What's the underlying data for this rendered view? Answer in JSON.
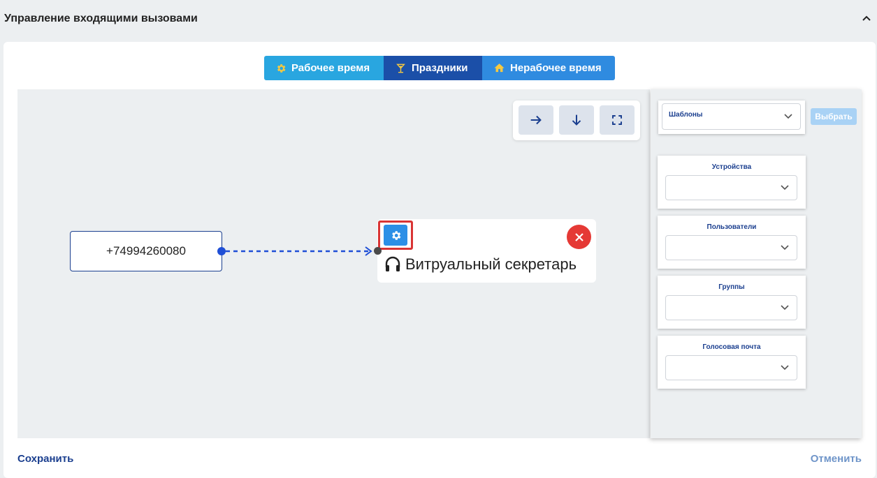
{
  "header": {
    "title": "Управление входящими вызовами",
    "collapse_icon": "chevron-up-icon"
  },
  "tabs": [
    {
      "label": "Рабочее время",
      "icon": "gear-icon",
      "color": "#29a6e0"
    },
    {
      "label": "Праздники",
      "icon": "cocktail-icon",
      "color": "#1b4fa8"
    },
    {
      "label": "Нерабочее время",
      "icon": "home-icon",
      "color": "#2f8be0"
    }
  ],
  "toolbar": {
    "icons": [
      "arrow-right-icon",
      "arrow-down-icon",
      "fullscreen-icon"
    ]
  },
  "flow": {
    "phone_number": "+74994260080",
    "secretary_label": "Витруальный секретарь",
    "secretary_icon": "headset-icon"
  },
  "sidebar": {
    "templates_label": "Шаблоны",
    "pick_button": "Выбрать",
    "groups": [
      {
        "title": "Устройства"
      },
      {
        "title": "Пользователи"
      },
      {
        "title": "Группы"
      },
      {
        "title": "Голосовая почта"
      }
    ]
  },
  "footer": {
    "save_label": "Сохранить",
    "cancel_label": "Отменить"
  },
  "colors": {
    "accent": "#1b3f8f",
    "close": "#e53935",
    "highlight": "#d93434"
  }
}
